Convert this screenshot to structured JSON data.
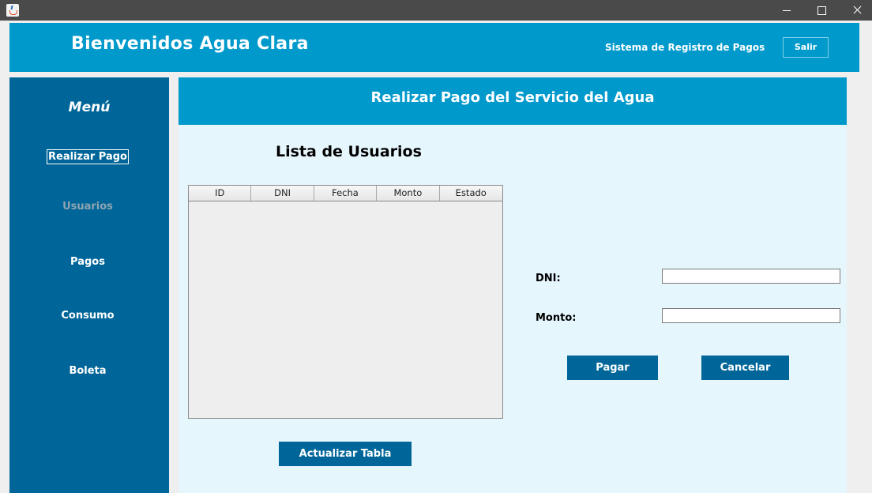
{
  "window": {
    "icon": "java-cup-icon",
    "controls": {
      "minimize": "minimize-icon",
      "maximize": "maximize-icon",
      "close": "close-icon"
    }
  },
  "header": {
    "title": "Bienvenidos Agua Clara",
    "subtitle": "Sistema de Registro de Pagos",
    "logout_label": "Salir"
  },
  "sidebar": {
    "title": "Menú",
    "items": [
      {
        "label": "Realizar Pago",
        "state": "selected"
      },
      {
        "label": "Usuarios",
        "state": "disabled"
      },
      {
        "label": "Pagos",
        "state": "normal"
      },
      {
        "label": "Consumo",
        "state": "normal"
      },
      {
        "label": "Boleta",
        "state": "normal"
      }
    ]
  },
  "main": {
    "banner_title": "Realizar Pago del Servicio del Agua",
    "list_title": "Lista de Usuarios",
    "table": {
      "columns": [
        "ID",
        "DNI",
        "Fecha",
        "Monto",
        "Estado"
      ],
      "rows": []
    },
    "refresh_label": "Actualizar Tabla",
    "form": {
      "dni_label": "DNI:",
      "dni_value": "",
      "monto_label": "Monto:",
      "monto_value": "",
      "pay_label": "Pagar",
      "cancel_label": "Cancelar"
    }
  },
  "colors": {
    "header_blue": "#0099cc",
    "sidebar_blue": "#006699",
    "button_blue": "#006699",
    "panel_bg": "#e6f6fd",
    "disabled_text": "#8fa4b2"
  }
}
